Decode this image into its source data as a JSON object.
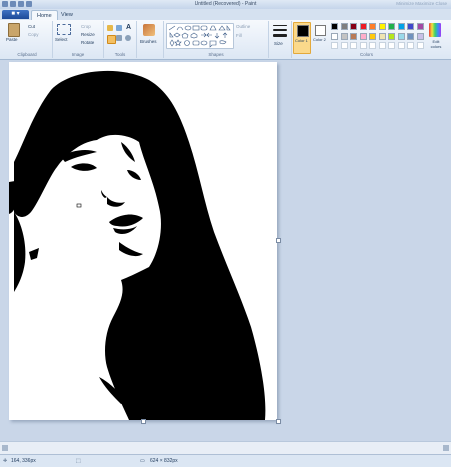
{
  "window": {
    "title": "Untitled (Recovered) - Paint",
    "controls": "Minimize  Maximize  Close"
  },
  "tabs": {
    "file_label": "■ ▾",
    "home": "Home",
    "view": "View"
  },
  "ribbon": {
    "clipboard": {
      "paste": "Paste",
      "cut": "Cut",
      "copy": "Copy",
      "label": "Clipboard"
    },
    "image": {
      "select": "Select",
      "crop": "Crop",
      "resize": "Resize",
      "rotate": "Rotate",
      "label": "Image"
    },
    "tools": {
      "label": "Tools",
      "text_tool": "A"
    },
    "brushes": {
      "label": "Brushes"
    },
    "shapes": {
      "outline": "Outline",
      "fill": "Fill",
      "label": "Shapes"
    },
    "size": {
      "label": "Size"
    },
    "color1": {
      "label": "Color 1"
    },
    "color2": {
      "label": "Color 2"
    },
    "colors": {
      "label": "Colors",
      "edit": "Edit colors"
    },
    "palette": [
      "#000000",
      "#7f7f7f",
      "#880015",
      "#ed1c24",
      "#ff7f27",
      "#fff200",
      "#22b14c",
      "#00a2e8",
      "#3f48cc",
      "#a349a4",
      "#ffffff",
      "#c3c3c3",
      "#b97a57",
      "#ffaec9",
      "#ffc90e",
      "#efe4b0",
      "#b5e61d",
      "#99d9ea",
      "#7092be",
      "#c8bfe7"
    ]
  },
  "status": {
    "cursor_pos": "164, 336px",
    "canvas_size": "624 × 832px"
  }
}
